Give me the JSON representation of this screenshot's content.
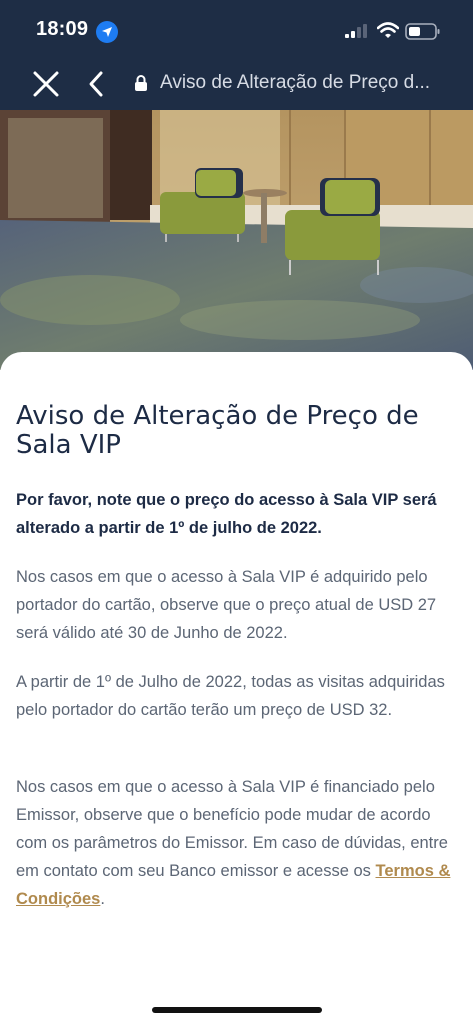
{
  "status_bar": {
    "time": "18:09",
    "icons": [
      "location-arrow-icon",
      "cellular-signal-icon",
      "wifi-icon",
      "battery-icon"
    ]
  },
  "nav": {
    "title": "Aviso de Alteração de Preço d...",
    "close_icon": "close-icon",
    "back_icon": "chevron-left-icon",
    "lock_icon": "lock-icon"
  },
  "article": {
    "title": "Aviso de Alteração de Preço de Sala VIP",
    "intro_bold": "Por favor, note que o preço do acesso à Sala VIP será alterado a partir de 1º de julho de 2022.",
    "para1": "Nos casos em que o acesso à Sala VIP é adquirido pelo portador do cartão, observe que o preço atual de USD 27 será válido até 30 de Junho de 2022.",
    "para2": "A partir de 1º de Julho de 2022, todas as visitas adquiridas pelo portador do cartão terão um preço de USD 32.",
    "para3": "Nos casos em que o acesso à Sala VIP é financiado pelo Emissor, observe que o benefício pode mudar de acordo com os parâmetros do Emissor. Em caso de dúvidas, entre em contato com seu Banco emissor e acesse os ",
    "terms_link": "Termos & Condições",
    "para3_end": "."
  },
  "colors": {
    "header_bg": "#1e2d45",
    "title_text": "#1d2b45",
    "body_text": "#5c6675",
    "link": "#b08a4e"
  }
}
